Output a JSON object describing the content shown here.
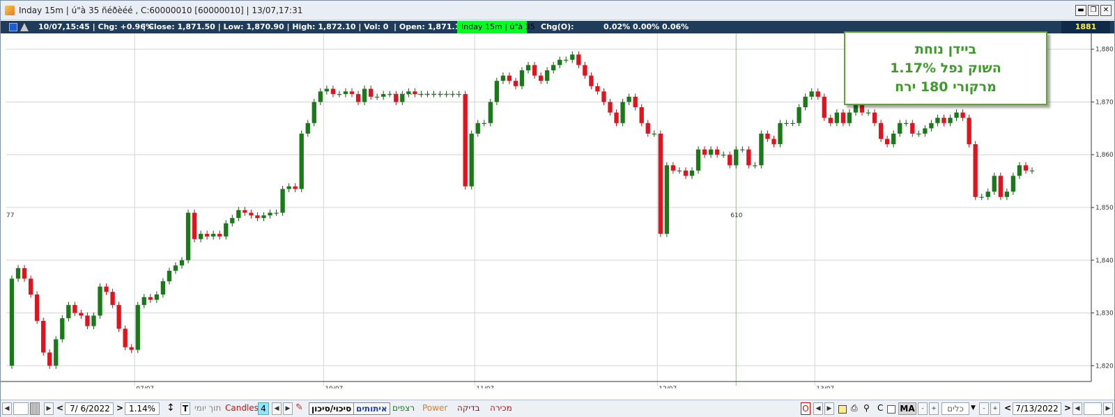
{
  "titlebar": {
    "title": "Inday 15m | ú\"à 35 ñéðèéé , C:60000010  [60000010]  | 13/07,17:31",
    "buttons": [
      "▬",
      "❐",
      "✕"
    ]
  },
  "infobar": {
    "datetime_chg": "10/07,15:45 | Chg: +0.96%",
    "close_low_high_vol": "| Close: 1,871.50 | Low: 1,870.90 | High: 1,872.10 | Vol: 0",
    "open": "| Open: 1,871.15",
    "instrument_tag": "Inday 15m | ú\"à 35",
    "chg_o_label": "Chg(O):",
    "chg_o_values": "0.02% 0.00% 0.06%",
    "current_price": "1881"
  },
  "chart_data": {
    "type": "candlestick",
    "y_ticks": [
      "1,880",
      "1,870",
      "1,860",
      "1,850",
      "1,840",
      "1,830",
      "1,820"
    ],
    "ylim": [
      1817,
      1883
    ],
    "x_labels": [
      "07/07",
      "10/07",
      "11/07",
      "12/07",
      "13/07"
    ],
    "left_edge_label": "77",
    "mid_label": "610",
    "grid": true,
    "up_color": "#1a7a1a",
    "down_color": "#e0141e",
    "candles_close": [
      1836.5,
      1838.5,
      1836.5,
      1833.5,
      1828.5,
      1822.5,
      1820,
      1825,
      1829,
      1831.5,
      1830,
      1829.5,
      1827.5,
      1829.5,
      1835,
      1834,
      1831.5,
      1827,
      1823.5,
      1823,
      1831.5,
      1833,
      1832.5,
      1833.5,
      1836,
      1838,
      1839,
      1840,
      1849,
      1844,
      1845,
      1844.5,
      1845,
      1844.5,
      1847,
      1848,
      1849.5,
      1849,
      1848.5,
      1848,
      1848.5,
      1849,
      1849,
      1853.5,
      1854,
      1853.5,
      1864,
      1866,
      1870,
      1872,
      1872.5,
      1871.5,
      1871.5,
      1872,
      1871.5,
      1870,
      1872.5,
      1871,
      1871,
      1871.5,
      1871.5,
      1870,
      1871.5,
      1872,
      1871.5,
      1871.5,
      1871.5,
      1871.5,
      1871.5,
      1871.5,
      1871.5,
      1871.5,
      1854,
      1864,
      1866,
      1866,
      1870,
      1874,
      1875,
      1874,
      1873,
      1876,
      1877,
      1875,
      1874,
      1876,
      1877,
      1878,
      1878,
      1879,
      1877,
      1875,
      1873,
      1872,
      1870,
      1868,
      1866,
      1870,
      1871,
      1869,
      1866,
      1864,
      1864,
      1845,
      1858,
      1857,
      1857,
      1856,
      1857,
      1861,
      1860,
      1861,
      1860,
      1860,
      1858,
      1861,
      1861,
      1858,
      1858,
      1864,
      1863,
      1862,
      1866,
      1866,
      1866,
      1869,
      1871,
      1872,
      1871,
      1867,
      1866,
      1868,
      1866,
      1868,
      1870,
      1868,
      1868,
      1866,
      1863,
      1862,
      1864,
      1866,
      1866,
      1864,
      1864,
      1865,
      1866,
      1867,
      1866,
      1867,
      1868,
      1867,
      1862,
      1852,
      1852,
      1853,
      1856,
      1852,
      1853,
      1856,
      1858,
      1857,
      1857
    ]
  },
  "annotation": {
    "line1": "ביידן נוחת",
    "line2": "השוק נפל 1.17%",
    "line3": "מרקורי 180 ירח"
  },
  "bottombar": {
    "date_left": "7/  6/2022",
    "percent": "1.14%",
    "t_label": "T",
    "intraday_label": "תוך יומי",
    "candles_label": "Candles",
    "candles_value": "4",
    "risk_button": "סיכוי/סיכון",
    "signals_button": "איתותים",
    "continuous_label": "רצפים",
    "power_label": "Power",
    "check_label": "בדיקה",
    "sell_label": "מכירה",
    "o_label": "O",
    "c_label": "C",
    "ma_label": "MA",
    "tools_select": "כלים",
    "date_right": "7/13/2022"
  }
}
